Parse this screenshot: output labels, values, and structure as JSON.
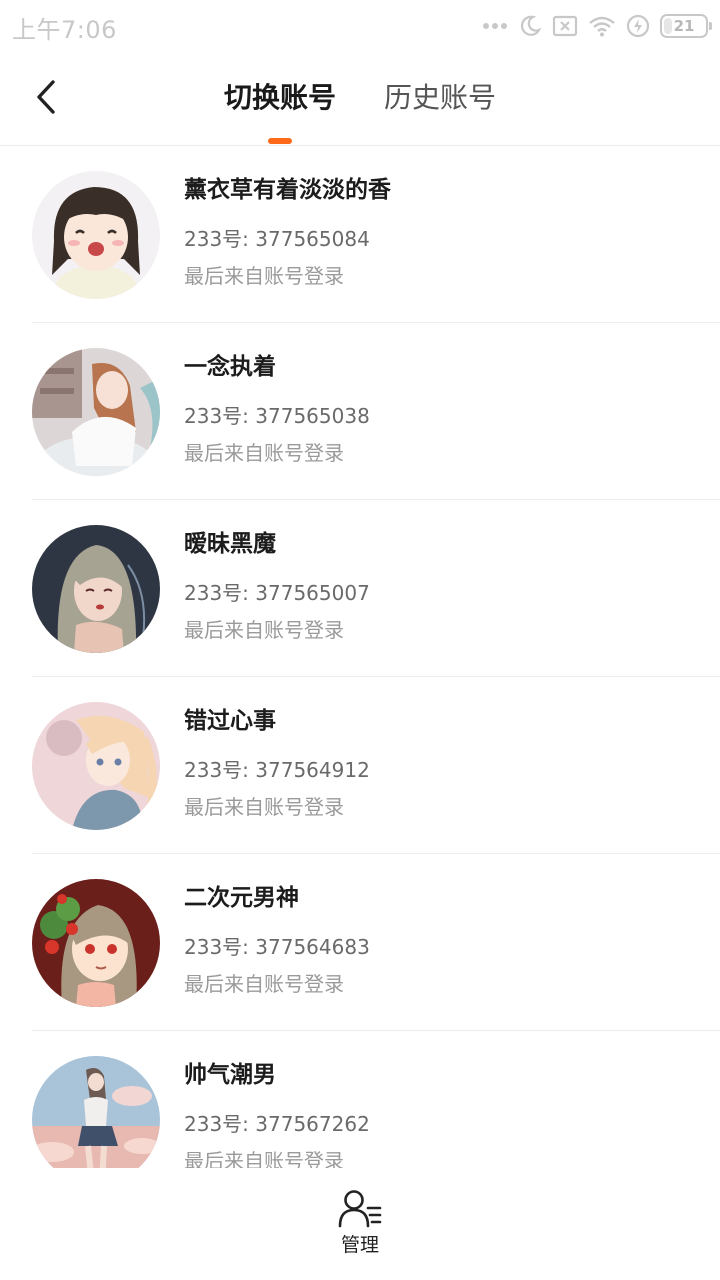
{
  "status_bar": {
    "time": "上午7:06",
    "battery": "21",
    "battery_fraction": 0.21,
    "icons": [
      "dots-icon",
      "moon-icon",
      "sim-off-icon",
      "wifi-icon",
      "charging-icon",
      "battery-icon"
    ]
  },
  "header": {
    "tabs": [
      {
        "label": "切换账号",
        "active": true
      },
      {
        "label": "历史账号",
        "active": false
      }
    ],
    "accent_color": "#ff6a1a"
  },
  "accounts": [
    {
      "nickname": "薰衣草有着淡淡的香",
      "uid_label": "233号: ",
      "uid": "377565084",
      "login_source": "最后来自账号登录"
    },
    {
      "nickname": "一念执着",
      "uid_label": "233号: ",
      "uid": "377565038",
      "login_source": "最后来自账号登录"
    },
    {
      "nickname": "暧昧黑魔",
      "uid_label": "233号: ",
      "uid": "377565007",
      "login_source": "最后来自账号登录"
    },
    {
      "nickname": "错过心事",
      "uid_label": "233号: ",
      "uid": "377564912",
      "login_source": "最后来自账号登录"
    },
    {
      "nickname": "二次元男神",
      "uid_label": "233号: ",
      "uid": "377564683",
      "login_source": "最后来自账号登录"
    },
    {
      "nickname": "帅气潮男",
      "uid_label": "233号: ",
      "uid": "377567262",
      "login_source": "最后来自账号登录"
    }
  ],
  "bottom_bar": {
    "manage_label": "管理",
    "manage_icon": "user-list-icon"
  }
}
